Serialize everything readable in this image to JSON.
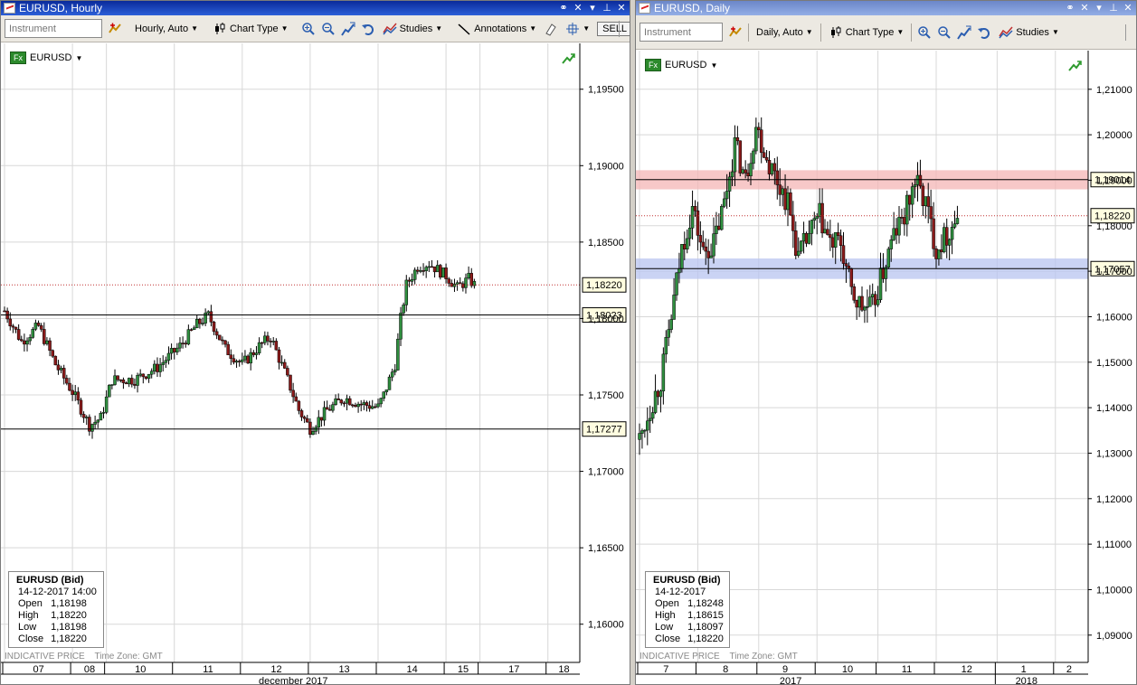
{
  "colors": {
    "candle_up": "#2f8f3f",
    "candle_down": "#8b1a1a",
    "wick": "#000000",
    "grid": "#d8d8d8",
    "resistance_band": "#f4b6b6",
    "support_band": "#b8c4f0",
    "current_price_line": "#c03030",
    "titlebar": "#1c48c0"
  },
  "hourly": {
    "title": "EURUSD, Hourly",
    "toolbar": {
      "instrument_placeholder": "Instrument",
      "period_label": "Hourly,  Auto",
      "chart_type_label": "Chart Type",
      "studies_label": "Studies",
      "annotations_label": "Annotations",
      "sell_label": "SELL"
    },
    "instrument_badge": "Fx",
    "instrument_name": "EURUSD",
    "info": {
      "title": "EURUSD (Bid)",
      "datetime": "14-12-2017 14:00",
      "rows": [
        {
          "k": "Open",
          "v": "1,18198"
        },
        {
          "k": "High",
          "v": "1,18220"
        },
        {
          "k": "Low",
          "v": "1,18198"
        },
        {
          "k": "Close",
          "v": "1,18220"
        }
      ]
    },
    "indicative": "INDICATIVE PRICE",
    "timezone": "Time Zone: GMT",
    "chart_data": {
      "type": "candlestick",
      "y_range": [
        1.1575,
        1.198
      ],
      "y_ticks": [
        "1,19500",
        "1,19000",
        "1,18500",
        "1,18000",
        "1,17500",
        "1,17000",
        "1,16500",
        "1,16000"
      ],
      "y_tick_values": [
        1.195,
        1.19,
        1.185,
        1.18,
        1.175,
        1.17,
        1.165,
        1.16
      ],
      "x_ticks": [
        "07",
        "08",
        "10",
        "11",
        "12",
        "13",
        "14",
        "15",
        "17",
        "18"
      ],
      "x_tick_positions": [
        0,
        24,
        36,
        60,
        84,
        108,
        132,
        156,
        168,
        192
      ],
      "x_max_index": 202,
      "month_label": "december 2017",
      "last_price": "1,18220",
      "last_price_value": 1.1822,
      "levels": [
        {
          "label": "1,18023",
          "value": 1.18023
        },
        {
          "label": "1,17277",
          "value": 1.17277
        }
      ],
      "path": [
        [
          0,
          1.1805
        ],
        [
          6,
          1.1785
        ],
        [
          12,
          1.1795
        ],
        [
          18,
          1.177
        ],
        [
          24,
          1.1752
        ],
        [
          30,
          1.173
        ],
        [
          34,
          1.1735
        ],
        [
          38,
          1.176
        ],
        [
          46,
          1.176
        ],
        [
          54,
          1.1768
        ],
        [
          62,
          1.1782
        ],
        [
          68,
          1.1796
        ],
        [
          72,
          1.1802
        ],
        [
          78,
          1.178
        ],
        [
          84,
          1.177
        ],
        [
          90,
          1.1782
        ],
        [
          94,
          1.1788
        ],
        [
          100,
          1.176
        ],
        [
          104,
          1.174
        ],
        [
          108,
          1.1728
        ],
        [
          114,
          1.174
        ],
        [
          120,
          1.1748
        ],
        [
          126,
          1.1744
        ],
        [
          132,
          1.1742
        ],
        [
          134,
          1.175
        ],
        [
          138,
          1.177
        ],
        [
          140,
          1.18
        ],
        [
          142,
          1.1822
        ],
        [
          146,
          1.1834
        ],
        [
          150,
          1.1836
        ],
        [
          156,
          1.1828
        ],
        [
          160,
          1.182
        ],
        [
          164,
          1.1826
        ],
        [
          166,
          1.1822
        ]
      ]
    }
  },
  "daily": {
    "title": "EURUSD, Daily",
    "toolbar": {
      "instrument_placeholder": "Instrument",
      "period_label": "Daily,  Auto",
      "chart_type_label": "Chart Type",
      "studies_label": "Studies"
    },
    "instrument_badge": "Fx",
    "instrument_name": "EURUSD",
    "info": {
      "title": "EURUSD (Bid)",
      "datetime": "14-12-2017",
      "rows": [
        {
          "k": "Open",
          "v": "1,18248"
        },
        {
          "k": "High",
          "v": "1,18615"
        },
        {
          "k": "Low",
          "v": "1,18097"
        },
        {
          "k": "Close",
          "v": "1,18220"
        }
      ]
    },
    "indicative": "INDICATIVE PRICE",
    "timezone": "Time Zone: GMT",
    "chart_data": {
      "type": "candlestick",
      "y_range": [
        1.084,
        1.2185
      ],
      "y_ticks": [
        "1,21000",
        "1,20000",
        "1,19000",
        "1,18000",
        "1,17000",
        "1,16000",
        "1,15000",
        "1,14000",
        "1,13000",
        "1,12000",
        "1,11000",
        "1,10000",
        "1,09000"
      ],
      "y_tick_values": [
        1.21,
        1.2,
        1.19,
        1.18,
        1.17,
        1.16,
        1.15,
        1.14,
        1.13,
        1.12,
        1.11,
        1.1,
        1.09
      ],
      "x_ticks": [
        "7",
        "8",
        "9",
        "10",
        "11",
        "12",
        "1",
        "2"
      ],
      "x_tick_positions": [
        0,
        22,
        45,
        67,
        90,
        112,
        135,
        157
      ],
      "x_max_index": 168,
      "year_labels": [
        "2017",
        "2018"
      ],
      "year_positions": [
        57,
        146
      ],
      "last_price": "1,18220",
      "last_price_value": 1.1822,
      "resistance": {
        "label": "1,19014",
        "value": 1.19014,
        "band": [
          1.188,
          1.1922
        ]
      },
      "support": {
        "label": "1,17057",
        "value": 1.17057,
        "band": [
          1.1683,
          1.1728
        ]
      },
      "path": [
        [
          0,
          1.133
        ],
        [
          4,
          1.14
        ],
        [
          8,
          1.146
        ],
        [
          12,
          1.16
        ],
        [
          16,
          1.175
        ],
        [
          20,
          1.184
        ],
        [
          24,
          1.174
        ],
        [
          28,
          1.176
        ],
        [
          32,
          1.185
        ],
        [
          36,
          1.198
        ],
        [
          40,
          1.19
        ],
        [
          44,
          1.202
        ],
        [
          48,
          1.195
        ],
        [
          52,
          1.19
        ],
        [
          56,
          1.185
        ],
        [
          60,
          1.173
        ],
        [
          64,
          1.178
        ],
        [
          68,
          1.182
        ],
        [
          72,
          1.176
        ],
        [
          76,
          1.176
        ],
        [
          80,
          1.165
        ],
        [
          84,
          1.162
        ],
        [
          88,
          1.162
        ],
        [
          92,
          1.17
        ],
        [
          96,
          1.178
        ],
        [
          100,
          1.182
        ],
        [
          104,
          1.19
        ],
        [
          108,
          1.185
        ],
        [
          112,
          1.175
        ],
        [
          116,
          1.178
        ],
        [
          120,
          1.1822
        ]
      ]
    }
  }
}
